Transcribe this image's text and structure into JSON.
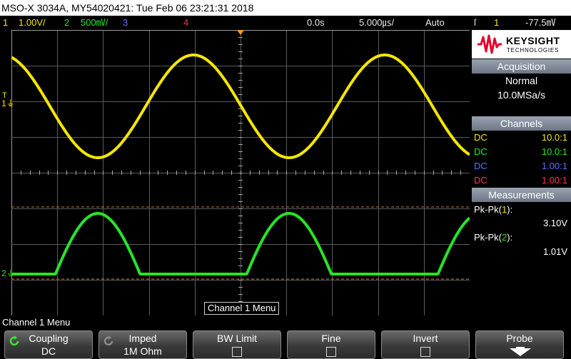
{
  "title_bar": {
    "text": "MSO-X 3034A, MY54020421: Tue Feb 06 23:21:31 2018"
  },
  "status_bar": {
    "ch1_num": "1",
    "ch1_scale": "1.00V/",
    "ch2_num": "2",
    "ch2_scale": "500㎷/",
    "ch3_num": "3",
    "ch4_num": "4",
    "time_offset": "0.0s",
    "time_scale": "5.000㎲/",
    "trigger_mode": "Auto",
    "trigger_icon": "ſ",
    "trigger_channel": "1",
    "trigger_level": "-77.5㎷"
  },
  "graticule": {
    "ch1_marker": "1",
    "ch2_marker": "2",
    "trigger_marker": "T"
  },
  "right_panel": {
    "brand": "KEYSIGHT",
    "brand_sub": "TECHNOLOGIES",
    "acquisition": {
      "header": "Acquisition",
      "mode": "Normal",
      "sample_rate": "10.0MSa/s"
    },
    "channels": {
      "header": "Channels",
      "rows": [
        {
          "coupling": "DC",
          "probe": "10.0:1",
          "color": "#f5e600"
        },
        {
          "coupling": "DC",
          "probe": "10.0:1",
          "color": "#27e427"
        },
        {
          "coupling": "DC",
          "probe": "1.00:1",
          "color": "#5b6bff"
        },
        {
          "coupling": "DC",
          "probe": "1.00:1",
          "color": "#ff3355"
        }
      ]
    },
    "measurements": {
      "header": "Measurements",
      "m1_label_pre": "Pk-Pk(",
      "m1_ch": "1",
      "m1_label_post": "):",
      "m1_value": "3.10V",
      "m2_label_pre": "Pk-Pk(",
      "m2_ch": "2",
      "m2_label_post": "):",
      "m2_value": "1.01V"
    }
  },
  "screen_label": "Channel 1 Menu",
  "menu_title": "Channel 1 Menu",
  "softkeys": [
    {
      "label": "Coupling",
      "value": "DC",
      "icon": "knob-icon"
    },
    {
      "label": "Imped",
      "value": "1M Ohm",
      "icon": "knob-icon"
    },
    {
      "label": "BW Limit",
      "value": "",
      "icon": "checkbox"
    },
    {
      "label": "Fine",
      "value": "",
      "icon": "checkbox"
    },
    {
      "label": "Invert",
      "value": "",
      "icon": "checkbox"
    },
    {
      "label": "Probe",
      "value": "",
      "icon": "arrow-down-icon"
    }
  ],
  "colors": {
    "ch1": "#f5e600",
    "ch2": "#27e427",
    "ch3": "#5b6bff",
    "ch4": "#ff3355",
    "trigger": "#ff9a1e"
  }
}
